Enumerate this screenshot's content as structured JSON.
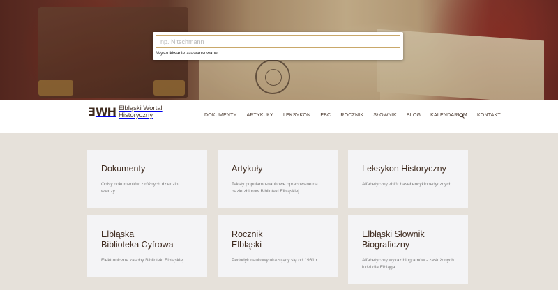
{
  "search": {
    "placeholder": "np. Nitschmann",
    "advanced_link": "Wyszukiwanie zaawansowane"
  },
  "logo": {
    "mark": "EWH",
    "line1": "Elbląski Wortal",
    "line2": "Historyczny"
  },
  "nav": {
    "items": [
      {
        "label": "DOKUMENTY"
      },
      {
        "label": "ARTYKUŁY"
      },
      {
        "label": "LEKSYKON"
      },
      {
        "label": "EBC"
      },
      {
        "label": "ROCZNIK"
      },
      {
        "label": "SŁOWNIK"
      },
      {
        "label": "BLOG"
      },
      {
        "label": "KALENDARIUM"
      },
      {
        "label": "KONTAKT"
      }
    ],
    "search_icon": "search-icon"
  },
  "cards": [
    {
      "title": "Dokumenty",
      "desc": "Opisy dokumentów z różnych dziedzin wiedzy."
    },
    {
      "title": "Artykuły",
      "desc": "Teksty popularno-naukowe opracowane na bazie zbiorów Biblioteki Elbląskiej."
    },
    {
      "title": "Leksykon Historyczny",
      "desc": "Alfabetyczny zbiór haseł encyklopedycznych."
    },
    {
      "title": "Elbląska\nBiblioteka Cyfrowa",
      "desc": "Elektroniczne zasoby Biblioteki Elbląskiej."
    },
    {
      "title": "Rocznik\nElbląski",
      "desc": "Periodyk naukowy ukazujący się od 1961 r."
    },
    {
      "title": "Elbląski Słownik\nBiograficzny",
      "desc": "Alfabetyczny wykaz biogramów - zasłużonych ludzi dla Elbląga."
    }
  ],
  "colors": {
    "brand": "#3e2a1e",
    "background": "#e6e1da",
    "card": "#f4f4f6"
  }
}
